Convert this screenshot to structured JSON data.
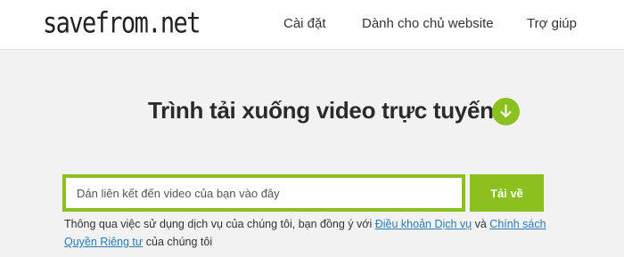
{
  "header": {
    "logo": "savefrom.net",
    "nav": {
      "settings": "Cài đặt",
      "webmaster": "Dành cho chủ website",
      "help": "Trợ giúp"
    }
  },
  "hero": {
    "title": "Trình tải xuống video trực tuyếnr",
    "icon": "download-arrow-icon"
  },
  "form": {
    "url_placeholder": "Dán liên kết đến video của bạn vào đây",
    "url_value": "",
    "download_label": "Tải về"
  },
  "terms": {
    "prefix": "Thông qua việc sử dụng dịch vụ của chúng tôi, bạn đồng ý với ",
    "tos_link": "Điều khoản Dịch vụ",
    "and": " và ",
    "privacy_link": "Chính sách Quyền Riêng tư",
    "suffix": " của chúng tôi"
  },
  "colors": {
    "accent": "#8bc11e",
    "page_bg": "#f2f2f2",
    "header_bg": "#ffffff",
    "link": "#2a7ab8"
  }
}
